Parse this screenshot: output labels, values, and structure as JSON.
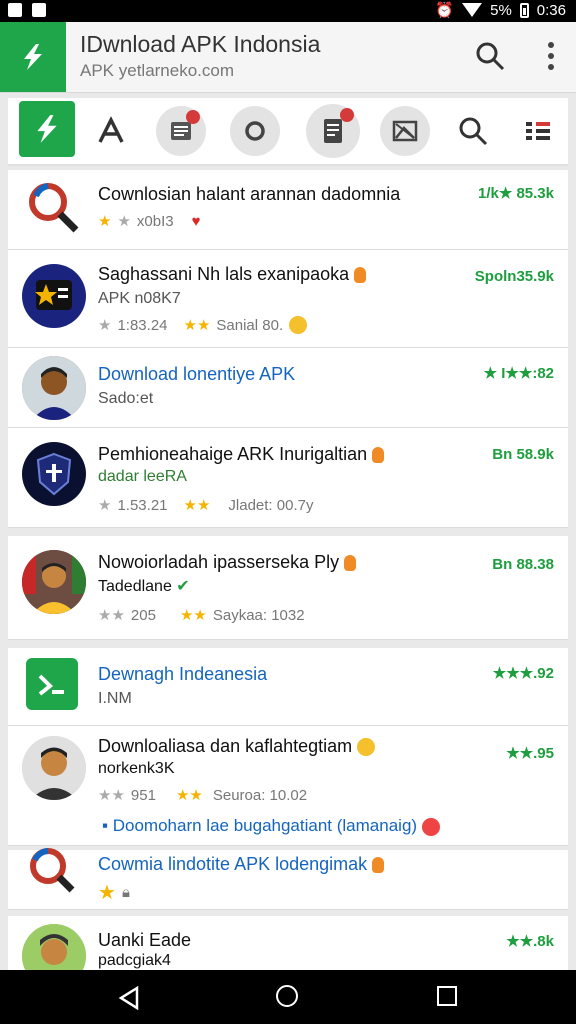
{
  "status_bar": {
    "time": "0:36",
    "battery": "5%"
  },
  "app_bar": {
    "title": "IDwnload APK Indonsia",
    "url": "APK yetlarneko.com"
  },
  "tabs": [
    {
      "name": "home",
      "icon": "app-logo-icon"
    },
    {
      "name": "apps",
      "icon": "a-letter-icon"
    },
    {
      "name": "news",
      "icon": "news-icon",
      "badge": ""
    },
    {
      "name": "refresh",
      "icon": "refresh-icon"
    },
    {
      "name": "document",
      "icon": "document-icon",
      "badge": ""
    },
    {
      "name": "gallery",
      "icon": "image-icon"
    },
    {
      "name": "search",
      "icon": "search-icon"
    },
    {
      "name": "list",
      "icon": "list-icon"
    }
  ],
  "items": [
    {
      "title": "Cownlosian halant arannan dadomnia",
      "meta": "x0bI3",
      "rating": "1/k★ 85.3k"
    },
    {
      "title": "Saghassani Nh lals exanipaoka",
      "sub": "APK n08K7",
      "meta_a": "1:83.24",
      "meta_b": "Sanial 80.",
      "rating": "Spoln35.9k"
    },
    {
      "title": "Download lonentiye APK",
      "sub": "Sado:et",
      "rating": "★ I★★:82"
    },
    {
      "title": "Pemhioneahaige ARK Inurigaltian",
      "sub": "dadar leeRA",
      "meta_a": "1.53.21",
      "meta_b": "Jladet: 00.7y",
      "rating": "Bn 58.9k"
    },
    {
      "title": "Nowoiorladah ipasserseka Ply",
      "sub": "Tadedlane",
      "meta_a": "205",
      "meta_b": "Saykaa: 1032",
      "rating": "Bn 88.38"
    },
    {
      "title": "Dewnagh Indeanesia",
      "sub": "I.NM",
      "rating": "★★★.92"
    },
    {
      "title": "Downloaliasa dan kaflahtegtiam",
      "sub": "norkenk3K",
      "meta_a": "951",
      "meta_b": "Seuroa: 10.02",
      "link": "Doomoharn lae bugahgatiant (lamanaig)",
      "rating": "★★.95"
    },
    {
      "title": "Cowmia lindotite APK lodengimak",
      "rating": ""
    },
    {
      "title": "Uanki Eade",
      "sub": "padcgiak4",
      "rating": "★★.8k"
    }
  ],
  "colors": {
    "accent": "#1fa64a",
    "link": "#1565c0",
    "rating": "#1e9e3e"
  }
}
